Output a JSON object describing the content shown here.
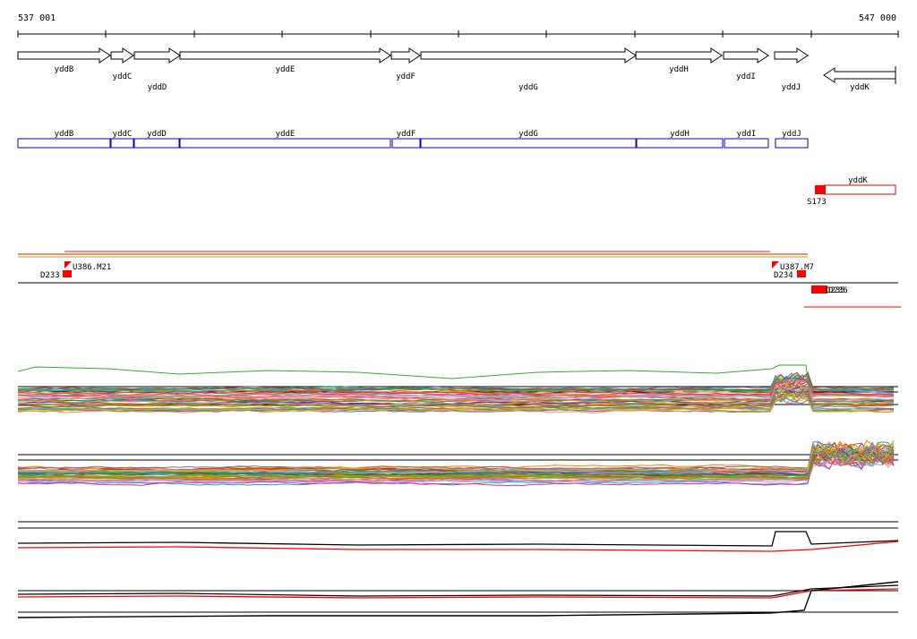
{
  "coords": {
    "start": "537 001",
    "end": "547 000"
  },
  "genes": [
    {
      "name": "yddB",
      "strand": "+"
    },
    {
      "name": "yddC",
      "strand": "+"
    },
    {
      "name": "yddD",
      "strand": "+"
    },
    {
      "name": "yddE",
      "strand": "+"
    },
    {
      "name": "yddF",
      "strand": "+"
    },
    {
      "name": "yddG",
      "strand": "+"
    },
    {
      "name": "yddH",
      "strand": "+"
    },
    {
      "name": "yddI",
      "strand": "+"
    },
    {
      "name": "yddJ",
      "strand": "+"
    },
    {
      "name": "yddK",
      "strand": "-"
    }
  ],
  "cds_track": [
    "yddB",
    "yddC",
    "yddD",
    "yddE",
    "yddF",
    "yddG",
    "yddH",
    "yddI",
    "yddJ"
  ],
  "cds_reverse": {
    "name": "yddK",
    "marker": "S173"
  },
  "features": [
    {
      "id": "U386.M21",
      "paired": "D233"
    },
    {
      "id": "U387.M7",
      "paired": "D234"
    },
    {
      "id": "D235",
      "paired": "D236"
    }
  ],
  "colors": {
    "gene_box": "#000000",
    "cds_plus": "#0000cc",
    "cds_minus": "#e00000",
    "feature": "#ff0000",
    "profile_primary": "#ff0000",
    "profile_secondary": "#000000",
    "outlier": "#33aa33"
  }
}
